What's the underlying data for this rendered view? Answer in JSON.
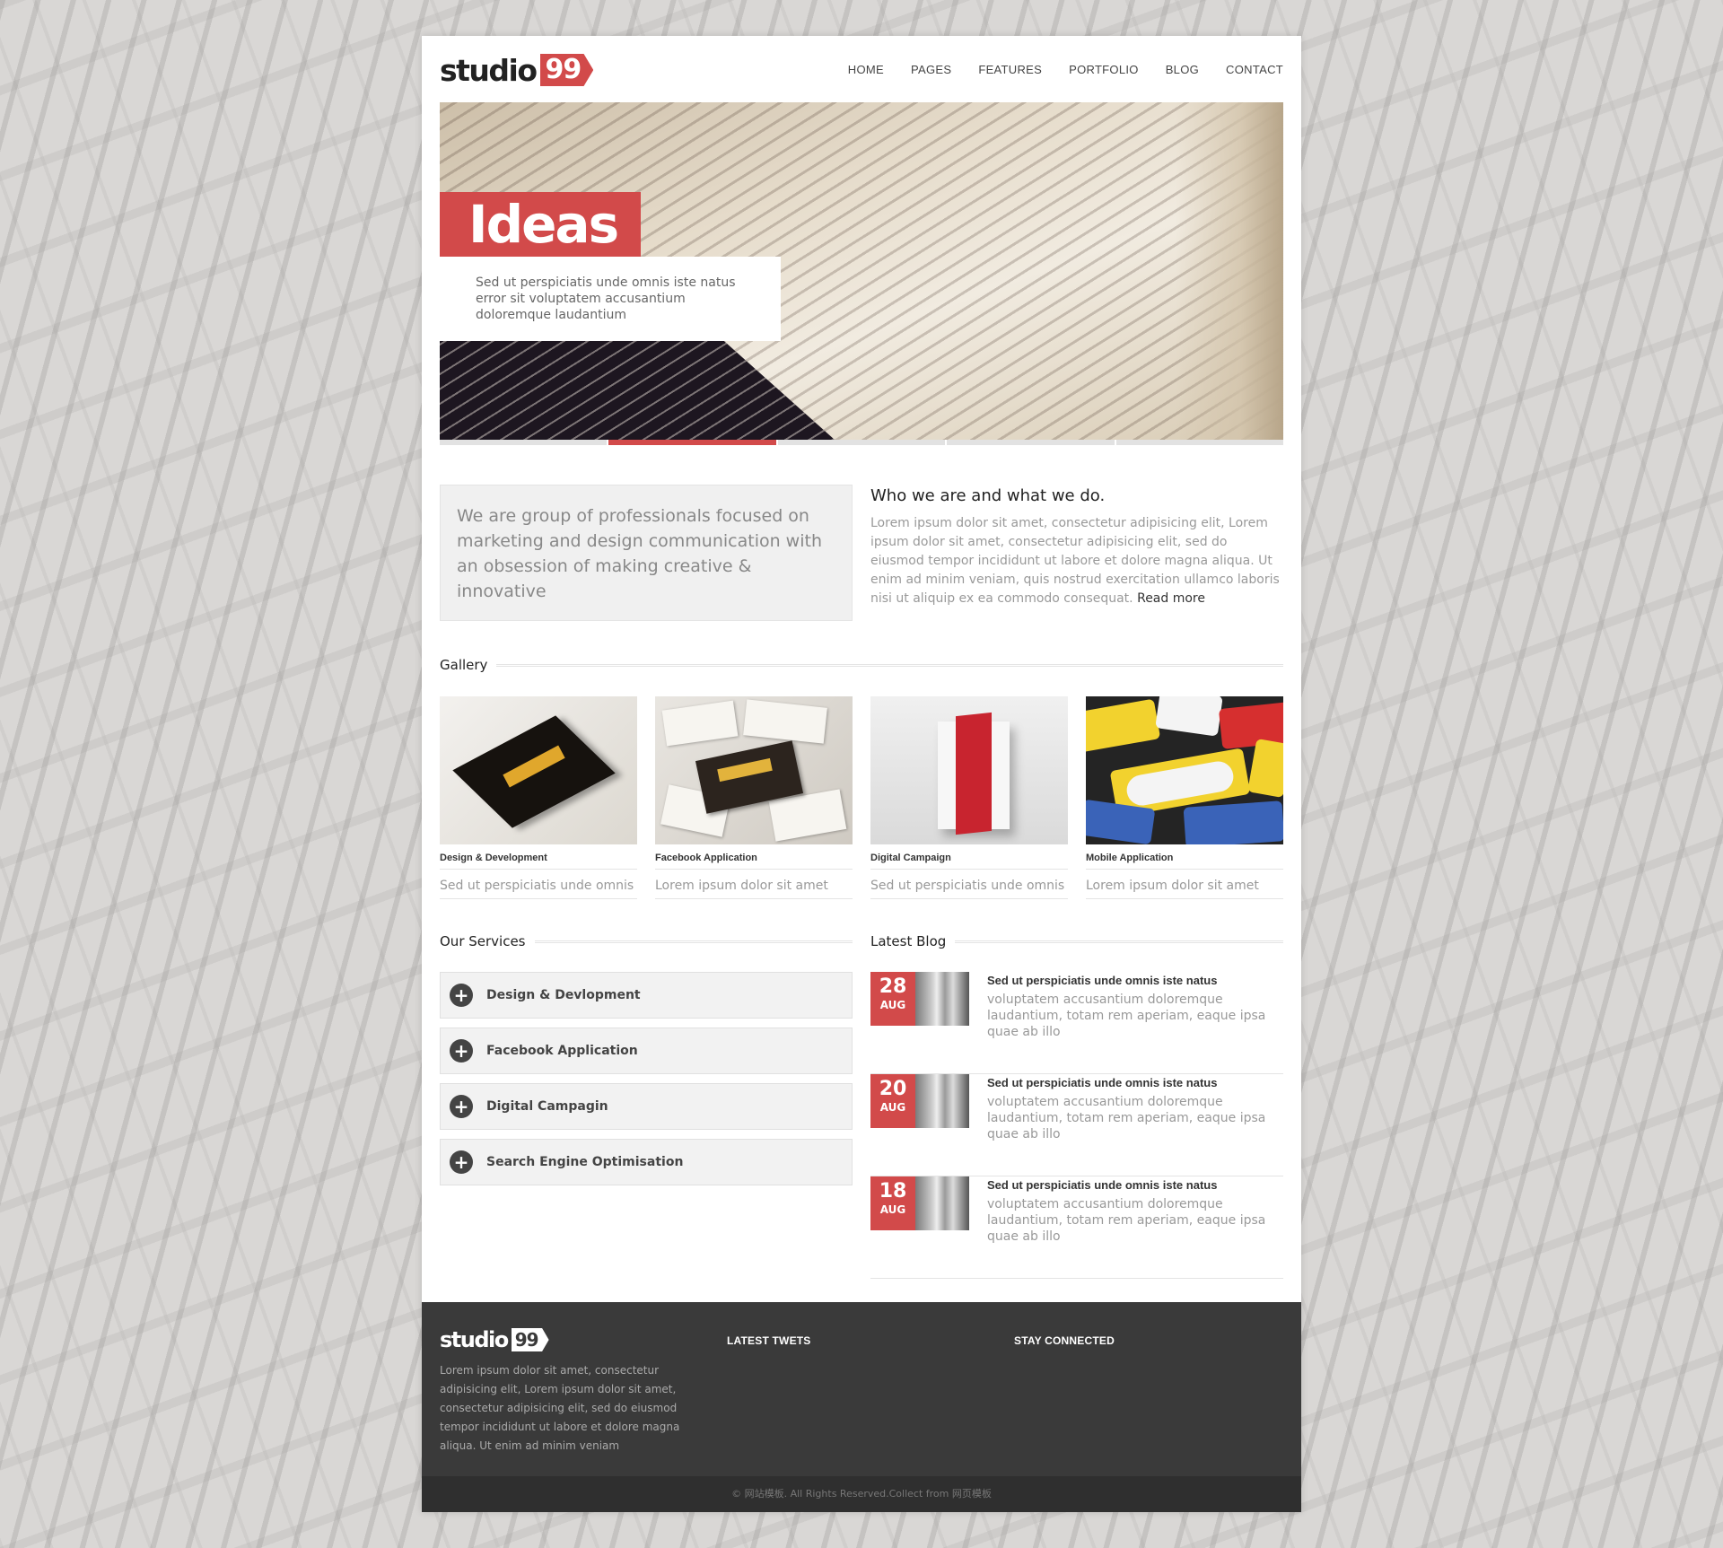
{
  "brand": {
    "name": "studio",
    "badge": "99"
  },
  "nav": [
    {
      "label": "HOME"
    },
    {
      "label": "PAGES"
    },
    {
      "label": "FEATURES"
    },
    {
      "label": "PORTFOLIO"
    },
    {
      "label": "BLOG"
    },
    {
      "label": "CONTACT"
    }
  ],
  "hero": {
    "title": "Ideas",
    "caption": "Sed ut perspiciatis unde omnis iste natus error sit voluptatem accusantium doloremque laudantium",
    "slides": 5,
    "active_slide": 2
  },
  "intro": {
    "tagline": "We are group of professionals focused on marketing and design communication with an obsession of making creative & innovative",
    "heading": "Who we are and what we do.",
    "body": "Lorem ipsum dolor sit amet, consectetur adipisicing elit, Lorem ipsum dolor sit amet, consectetur adipisicing elit, sed do eiusmod tempor incididunt ut labore et dolore magna aliqua. Ut enim ad minim veniam, quis nostrud exercitation ullamco laboris nisi ut aliquip ex ea commodo consequat.",
    "read_more": "Read more"
  },
  "gallery": {
    "heading": "Gallery",
    "items": [
      {
        "title": "Design & Development",
        "desc": "Sed ut perspiciatis unde omnis"
      },
      {
        "title": "Facebook Application",
        "desc": "Lorem ipsum dolor sit amet"
      },
      {
        "title": "Digital Campaign",
        "desc": "Sed ut perspiciatis unde omnis"
      },
      {
        "title": "Mobile Application",
        "desc": "Lorem ipsum dolor sit amet"
      }
    ]
  },
  "services": {
    "heading": "Our Services",
    "items": [
      {
        "label": "Design & Devlopment"
      },
      {
        "label": "Facebook Application"
      },
      {
        "label": "Digital Campagin"
      },
      {
        "label": "Search Engine Optimisation"
      }
    ]
  },
  "blog": {
    "heading": "Latest Blog",
    "posts": [
      {
        "day": "28",
        "month": "AUG",
        "title": "Sed ut perspiciatis unde omnis iste natus",
        "text": "voluptatem accusantium doloremque laudantium, totam rem aperiam, eaque ipsa quae ab illo"
      },
      {
        "day": "20",
        "month": "AUG",
        "title": "Sed ut perspiciatis unde omnis iste natus",
        "text": "voluptatem accusantium doloremque laudantium, totam rem aperiam, eaque ipsa quae ab illo"
      },
      {
        "day": "18",
        "month": "AUG",
        "title": "Sed ut perspiciatis unde omnis iste natus",
        "text": "voluptatem accusantium doloremque laudantium, totam rem aperiam, eaque ipsa quae ab illo"
      }
    ]
  },
  "footer": {
    "about": "Lorem ipsum dolor sit amet, consectetur adipisicing elit, Lorem ipsum dolor sit amet, consectetur adipisicing elit, sed do eiusmod tempor incididunt ut labore et dolore magna aliqua. Ut enim ad minim veniam",
    "tweets_heading": "LATEST TWETS",
    "connected_heading": "STAY CONNECTED",
    "copyright": "© 网站模板. All Rights Reserved.Collect from 网页模板"
  },
  "colors": {
    "accent": "#d24a4a",
    "footer_bg": "#3a3a3a",
    "page_bg": "#d9d7d5"
  }
}
